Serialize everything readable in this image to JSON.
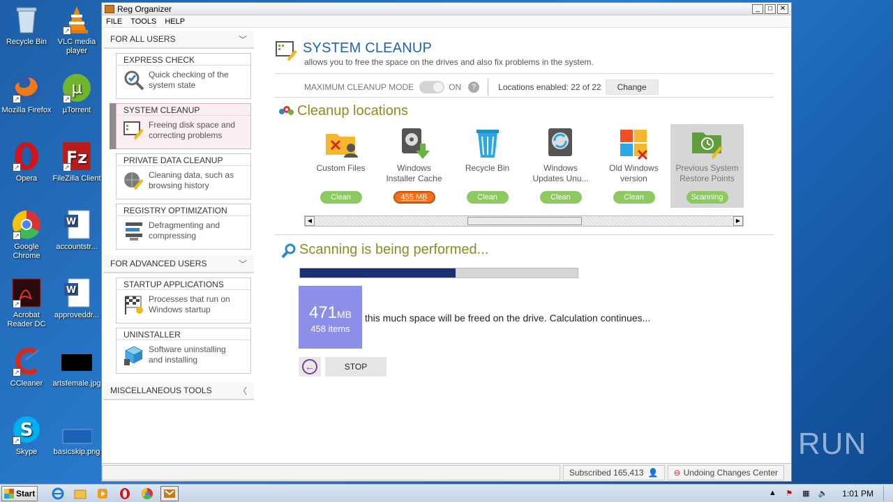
{
  "desktop": {
    "icons": [
      {
        "label": "Recycle Bin"
      },
      {
        "label": "VLC media player"
      },
      {
        "label": "Mozilla Firefox"
      },
      {
        "label": "µTorrent"
      },
      {
        "label": "Opera"
      },
      {
        "label": "FileZilla Client"
      },
      {
        "label": "Google Chrome"
      },
      {
        "label": "accountstr..."
      },
      {
        "label": "Acrobat Reader DC"
      },
      {
        "label": "approveddr..."
      },
      {
        "label": "CCleaner"
      },
      {
        "label": "artsfemale.jpg"
      },
      {
        "label": "Skype"
      },
      {
        "label": "basicskip.png"
      }
    ],
    "watermark": "ANY  RUN"
  },
  "window": {
    "title": "Reg Organizer",
    "controls": {
      "minimize": "_",
      "maximize": "□",
      "close": "✕"
    },
    "menu": [
      "FILE",
      "TOOLS",
      "HELP"
    ]
  },
  "sidebar": {
    "group_all": "FOR ALL USERS",
    "group_advanced": "FOR ADVANCED USERS",
    "group_misc": "MISCELLANEOUS TOOLS",
    "cards": [
      {
        "title": "EXPRESS CHECK",
        "desc1": "Quick checking of the",
        "desc2": "system state"
      },
      {
        "title": "SYSTEM CLEANUP",
        "desc1": "Freeing disk space and",
        "desc2": "correcting problems"
      },
      {
        "title": "PRIVATE DATA CLEANUP",
        "desc1": "Cleaning data, such as",
        "desc2": "browsing history"
      },
      {
        "title": "REGISTRY OPTIMIZATION",
        "desc1": "Defragmenting and",
        "desc2": "compressing"
      },
      {
        "title": "STARTUP APPLICATIONS",
        "desc1": "Processes that run on",
        "desc2": "Windows startup"
      },
      {
        "title": "UNINSTALLER",
        "desc1": "Software uninstalling",
        "desc2": "and installing"
      }
    ]
  },
  "main": {
    "title": "SYSTEM CLEANUP",
    "subtitle": "allows you to free the space on the drives and also fix problems in the system.",
    "mode_label": "MAXIMUM CLEANUP MODE",
    "mode_state": "ON",
    "help": "?",
    "locations_enabled": "Locations enabled: 22 of 22",
    "change_label": "Change",
    "locations_title": "Cleanup locations",
    "locations": [
      {
        "name1": "Custom Files",
        "name2": "",
        "button": "Clean"
      },
      {
        "name1": "Windows",
        "name2": "Installer Cache",
        "button": "455 MB"
      },
      {
        "name1": "Recycle Bin",
        "name2": "",
        "button": "Clean"
      },
      {
        "name1": "Windows",
        "name2": "Updates Unu...",
        "button": "Clean"
      },
      {
        "name1": "Old Windows",
        "name2": "version",
        "button": "Clean"
      },
      {
        "name1": "Previous System",
        "name2": "Restore Points",
        "button": "Scanning"
      }
    ],
    "scan_title": "Scanning is being performed...",
    "progress": 0.56,
    "freed_size": "471",
    "freed_unit": "MB",
    "freed_items": "458 items",
    "freed_text": "this much space will be freed on the drive. Calculation continues...",
    "stop_label": "STOP"
  },
  "statusbar": {
    "subscribed": "Subscribed 165,413",
    "undo": "Undoing Changes Center"
  },
  "taskbar": {
    "start": "Start",
    "clock": "1:01 PM"
  }
}
